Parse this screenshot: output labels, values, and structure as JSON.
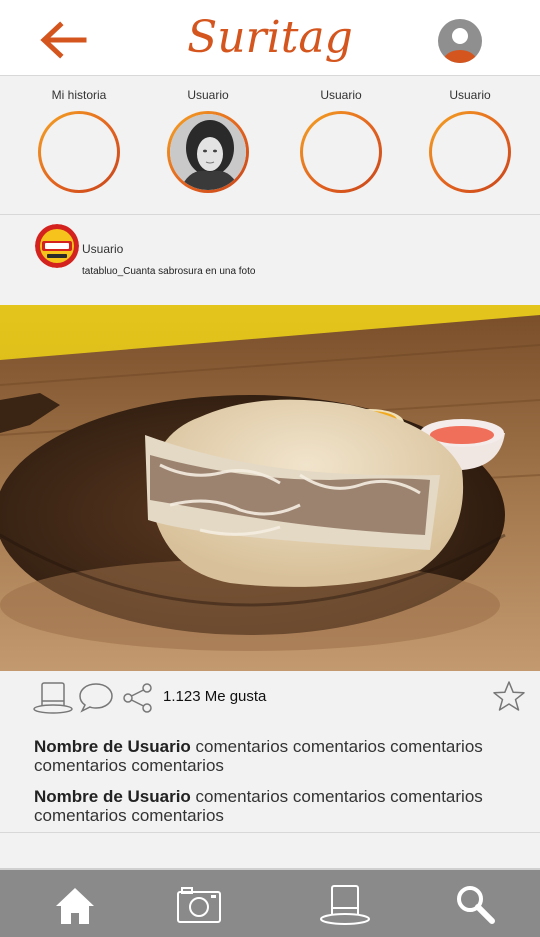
{
  "header": {
    "app_name": "Suritag",
    "back_icon": "arrow-left-icon",
    "profile_icon": "user-avatar-icon",
    "accent_color": "#d4551e"
  },
  "stories": [
    {
      "label": "Mi historia"
    },
    {
      "label": "Usuario"
    },
    {
      "label": "Usuario"
    },
    {
      "label": "Usuario"
    }
  ],
  "post": {
    "username": "Usuario",
    "caption": "tatabluo_Cuanta sabrosura en una foto",
    "likes_text": "1.123 Me gusta",
    "comments": [
      {
        "user": "Nombre de Usuario",
        "text": "comentarios comentarios comentarios comentarios comentarios"
      },
      {
        "user": "Nombre de Usuario",
        "text": "comentarios comentarios comentarios comentarios comentarios"
      }
    ]
  },
  "bottom_nav": {
    "items": [
      "home-icon",
      "camera-icon",
      "hat-icon",
      "search-icon"
    ],
    "bar_color": "#8a8a8a"
  }
}
